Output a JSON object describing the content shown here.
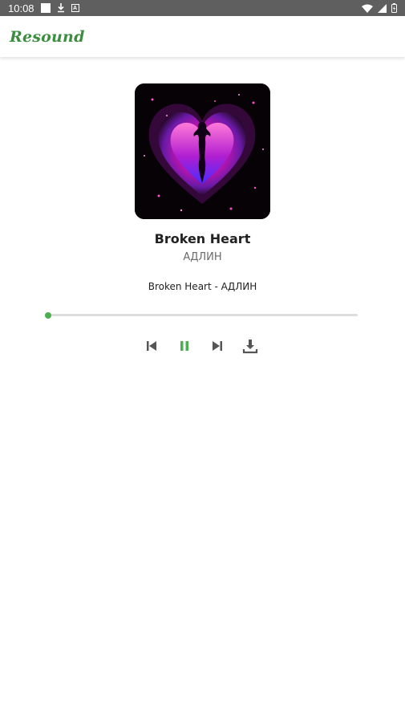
{
  "status_bar": {
    "time": "10:08"
  },
  "app": {
    "title": "Resound",
    "title_color": "#3c8d40"
  },
  "track": {
    "title": "Broken Heart",
    "artist": "АДЛИН",
    "now_playing": "Broken Heart - АДЛИН"
  },
  "playback": {
    "progress_fraction": 0.0,
    "accent_color": "#4caf50",
    "state": "playing"
  },
  "controls": {
    "previous_icon": "skip-previous-icon",
    "pause_icon": "pause-icon",
    "next_icon": "skip-next-icon",
    "download_icon": "download-icon"
  }
}
